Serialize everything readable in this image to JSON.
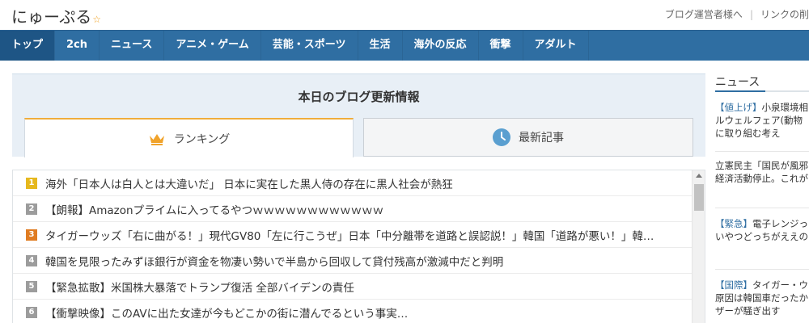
{
  "site": {
    "logo_text": "にゅーぷる",
    "logo_star": "☆",
    "links": [
      "ブログ運営者様へ",
      "リンクの削"
    ]
  },
  "nav": [
    "トップ",
    "2ch",
    "ニュース",
    "アニメ・ゲーム",
    "芸能・スポーツ",
    "生活",
    "海外の反応",
    "衝撃",
    "アダルト"
  ],
  "updates": {
    "title": "本日のブログ更新情報",
    "tabs": {
      "ranking": "ランキング",
      "latest": "最新記事"
    },
    "ranking": [
      {
        "rank": "1",
        "title": "海外「日本人は白人とは大違いだ」 日本に実在した黒人侍の存在に黒人社会が熱狂"
      },
      {
        "rank": "2",
        "title": "【朗報】Amazonプライムに入ってるやつｗｗｗｗｗｗｗｗｗｗｗｗ"
      },
      {
        "rank": "3",
        "title": "タイガーウッズ「右に曲がる！」現代GV80「左に行こうぜ」日本「中分離帯を道路と誤認説！」韓国「道路が悪い！」韓…"
      },
      {
        "rank": "4",
        "title": "韓国を見限ったみずほ銀行が資金を物凄い勢いで半島から回収して貸付残高が激減中だと判明"
      },
      {
        "rank": "5",
        "title": "【緊急拡散】米国株大暴落でトランプ復活 全部バイデンの責任"
      },
      {
        "rank": "6",
        "title": "【衝撃映像】このAVに出た女達が今もどこかの街に潜んでるという事実…"
      }
    ]
  },
  "sidebar": {
    "title": "ニュース",
    "items": [
      {
        "tag": "【値上げ】",
        "lines": [
          "小泉環境相",
          "ルウェルフェア(動物",
          "に取り組む考え"
        ]
      },
      {
        "tag": "",
        "lines": [
          "立憲民主「国民が風邪",
          "経済活動停止。これが"
        ]
      },
      {
        "tag": "【緊急】",
        "lines": [
          "電子レンジっ",
          "いやつどっちがええの"
        ]
      },
      {
        "tag": "【国際】",
        "lines": [
          "タイガー・ウ",
          "原因は韓国車だったか",
          "ザーが騒ぎ出す"
        ]
      }
    ]
  }
}
